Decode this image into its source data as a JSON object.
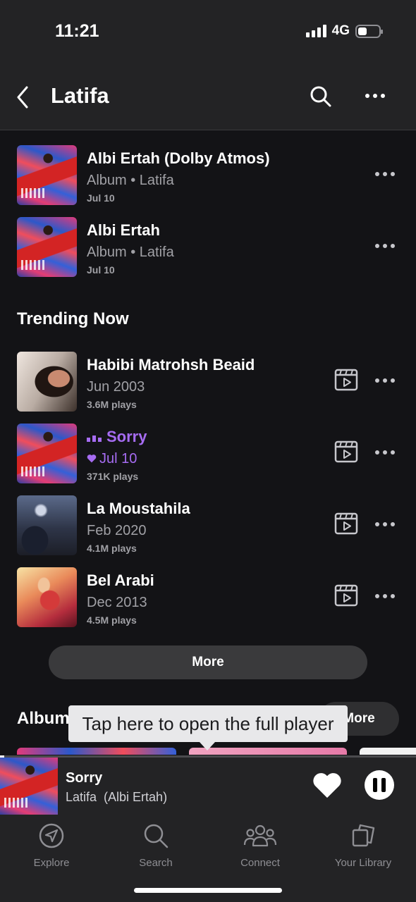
{
  "status": {
    "time": "11:21",
    "network": "4G"
  },
  "header": {
    "title": "Latifa"
  },
  "releases": [
    {
      "title": "Albi Ertah (Dolby Atmos)",
      "subtitle": "Album • Latifa",
      "date": "Jul 10"
    },
    {
      "title": "Albi Ertah",
      "subtitle": "Album • Latifa",
      "date": "Jul 10"
    }
  ],
  "trending": {
    "heading": "Trending Now",
    "tracks": [
      {
        "title": "Habibi Matrohsh Beaid",
        "date": "Jun 2003",
        "plays": "3.6M plays"
      },
      {
        "title": "Sorry",
        "date": "Jul 10",
        "plays": "371K plays",
        "playing": true,
        "liked": true
      },
      {
        "title": "La Moustahila",
        "date": "Feb 2020",
        "plays": "4.1M plays"
      },
      {
        "title": "Bel Arabi",
        "date": "Dec 2013",
        "plays": "4.5M plays"
      }
    ],
    "more_label": "More"
  },
  "albums": {
    "heading": "Albums",
    "more_label": "More"
  },
  "tooltip": {
    "text": "Tap here to open the full player"
  },
  "mini_player": {
    "title": "Sorry",
    "artist": "Latifa  (Albi Ertah)",
    "progress": 0.01
  },
  "tabs": [
    {
      "label": "Explore",
      "icon": "compass-icon"
    },
    {
      "label": "Search",
      "icon": "search-icon"
    },
    {
      "label": "Connect",
      "icon": "people-icon"
    },
    {
      "label": "Your Library",
      "icon": "library-icon"
    }
  ],
  "colors": {
    "background": "#131316",
    "bars": "#232325",
    "accent": "#a66cf2",
    "secondary_text": "#a1a1a6"
  }
}
